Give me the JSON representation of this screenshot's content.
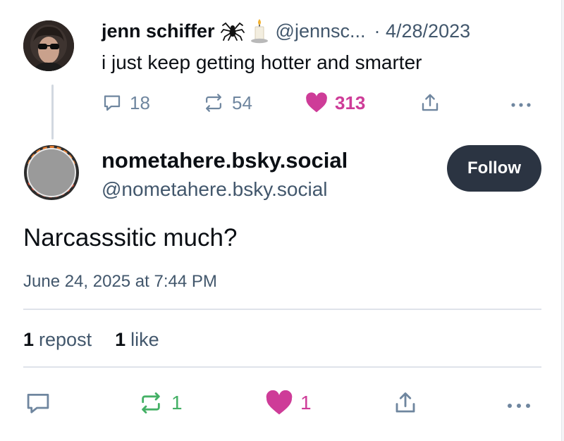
{
  "parent_post": {
    "author_name": "jenn schiffer",
    "author_emojis": [
      "spider",
      "candle"
    ],
    "handle": "@jennsc...",
    "date": "· 4/28/2023",
    "text": "i just keep getting hotter and smarter",
    "actions": {
      "reply_count": "18",
      "repost_count": "54",
      "like_count": "313"
    }
  },
  "reply_post": {
    "author_name": "nometahere.bsky.social",
    "handle": "@nometahere.bsky.social",
    "follow_label": "Follow",
    "text": "Narcasssitic much?",
    "timestamp": "June 24, 2025 at 7:44 PM",
    "stats": {
      "repost_num": "1",
      "repost_label": "repost",
      "like_num": "1",
      "like_label": "like"
    },
    "actions": {
      "repost_count": "1",
      "like_count": "1"
    }
  },
  "colors": {
    "text_primary": "#0b0f14",
    "text_secondary": "#42576c",
    "icon_gray": "#6f869f",
    "like_pink": "#ce3c98",
    "repost_green": "#44b065",
    "follow_button_bg": "#2b3442",
    "divider": "#dfe3ea"
  },
  "icons": [
    "reply-icon",
    "repost-icon",
    "like-heart-icon",
    "share-icon",
    "more-options-icon",
    "spider-emoji-icon",
    "candle-emoji-icon"
  ]
}
